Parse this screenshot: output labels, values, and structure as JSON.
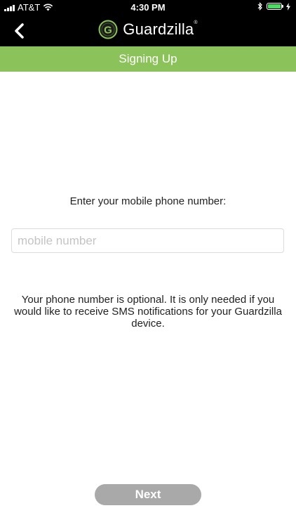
{
  "status_bar": {
    "carrier": "AT&T",
    "time": "4:30 PM",
    "battery_color": "#4cd964"
  },
  "nav": {
    "back_icon": "chevron-left-icon",
    "brand_name": "Guardzilla",
    "brand_mark": "®",
    "logo_letter": "G"
  },
  "title_bar": {
    "title": "Signing Up",
    "color": "#8bc25a"
  },
  "form": {
    "prompt": "Enter your mobile phone number:",
    "phone_placeholder": "mobile number",
    "phone_value": "",
    "note": "Your phone number is optional.  It is only needed if you would like to receive SMS notifications for your Guardzilla device."
  },
  "actions": {
    "next_label": "Next"
  }
}
